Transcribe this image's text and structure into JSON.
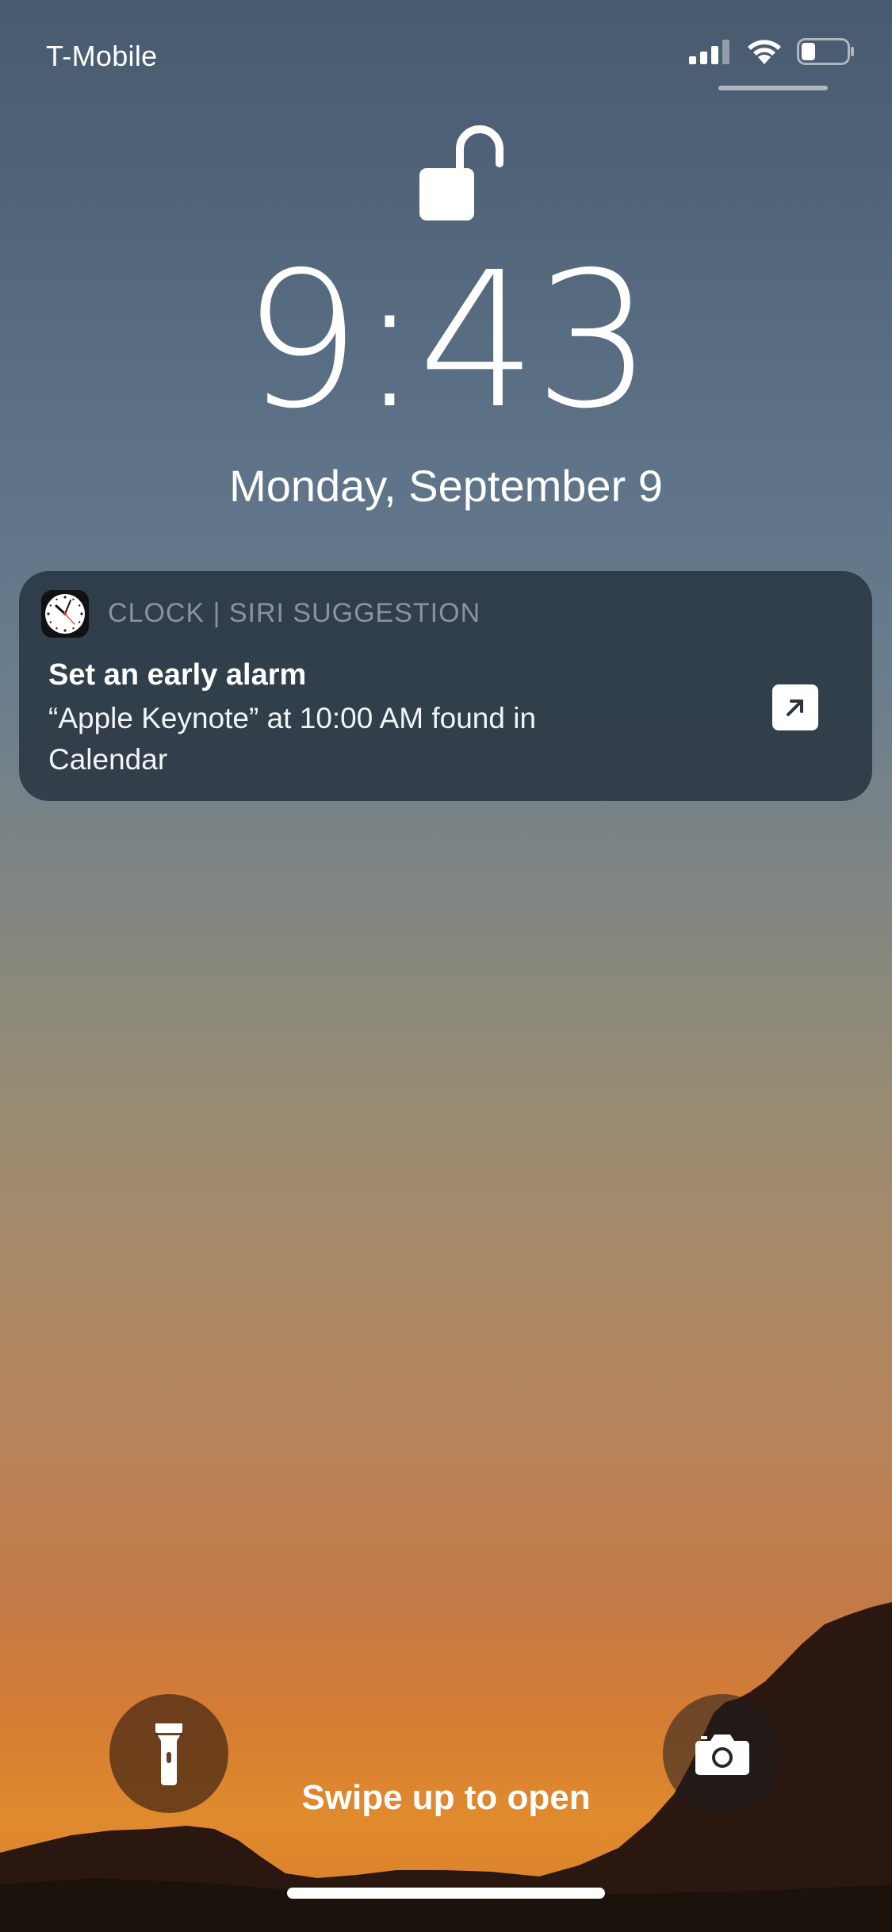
{
  "status_bar": {
    "carrier": "T-Mobile",
    "icons": [
      "cellular-signal-icon",
      "wifi-icon",
      "battery-icon"
    ],
    "battery_level": 0.25
  },
  "lock_screen": {
    "lock_icon": "unlocked-padlock-icon",
    "time": "9:43",
    "date": "Monday, September 9"
  },
  "notification": {
    "app_icon": "clock-app-icon",
    "app_name": "CLOCK | SIRI SUGGESTION",
    "title": "Set an early alarm",
    "body": "“Apple Keynote” at 10:00 AM found in Calendar",
    "action_icon": "open-arrow-icon"
  },
  "bottom": {
    "flashlight_icon": "flashlight-icon",
    "camera_icon": "camera-icon",
    "swipe_text": "Swipe up to open"
  },
  "colors": {
    "sky_top": "#485a6e",
    "horizon_orange": "#e08a2e",
    "notification_bg": "#283440",
    "flashlight_bg": "#502d14"
  }
}
